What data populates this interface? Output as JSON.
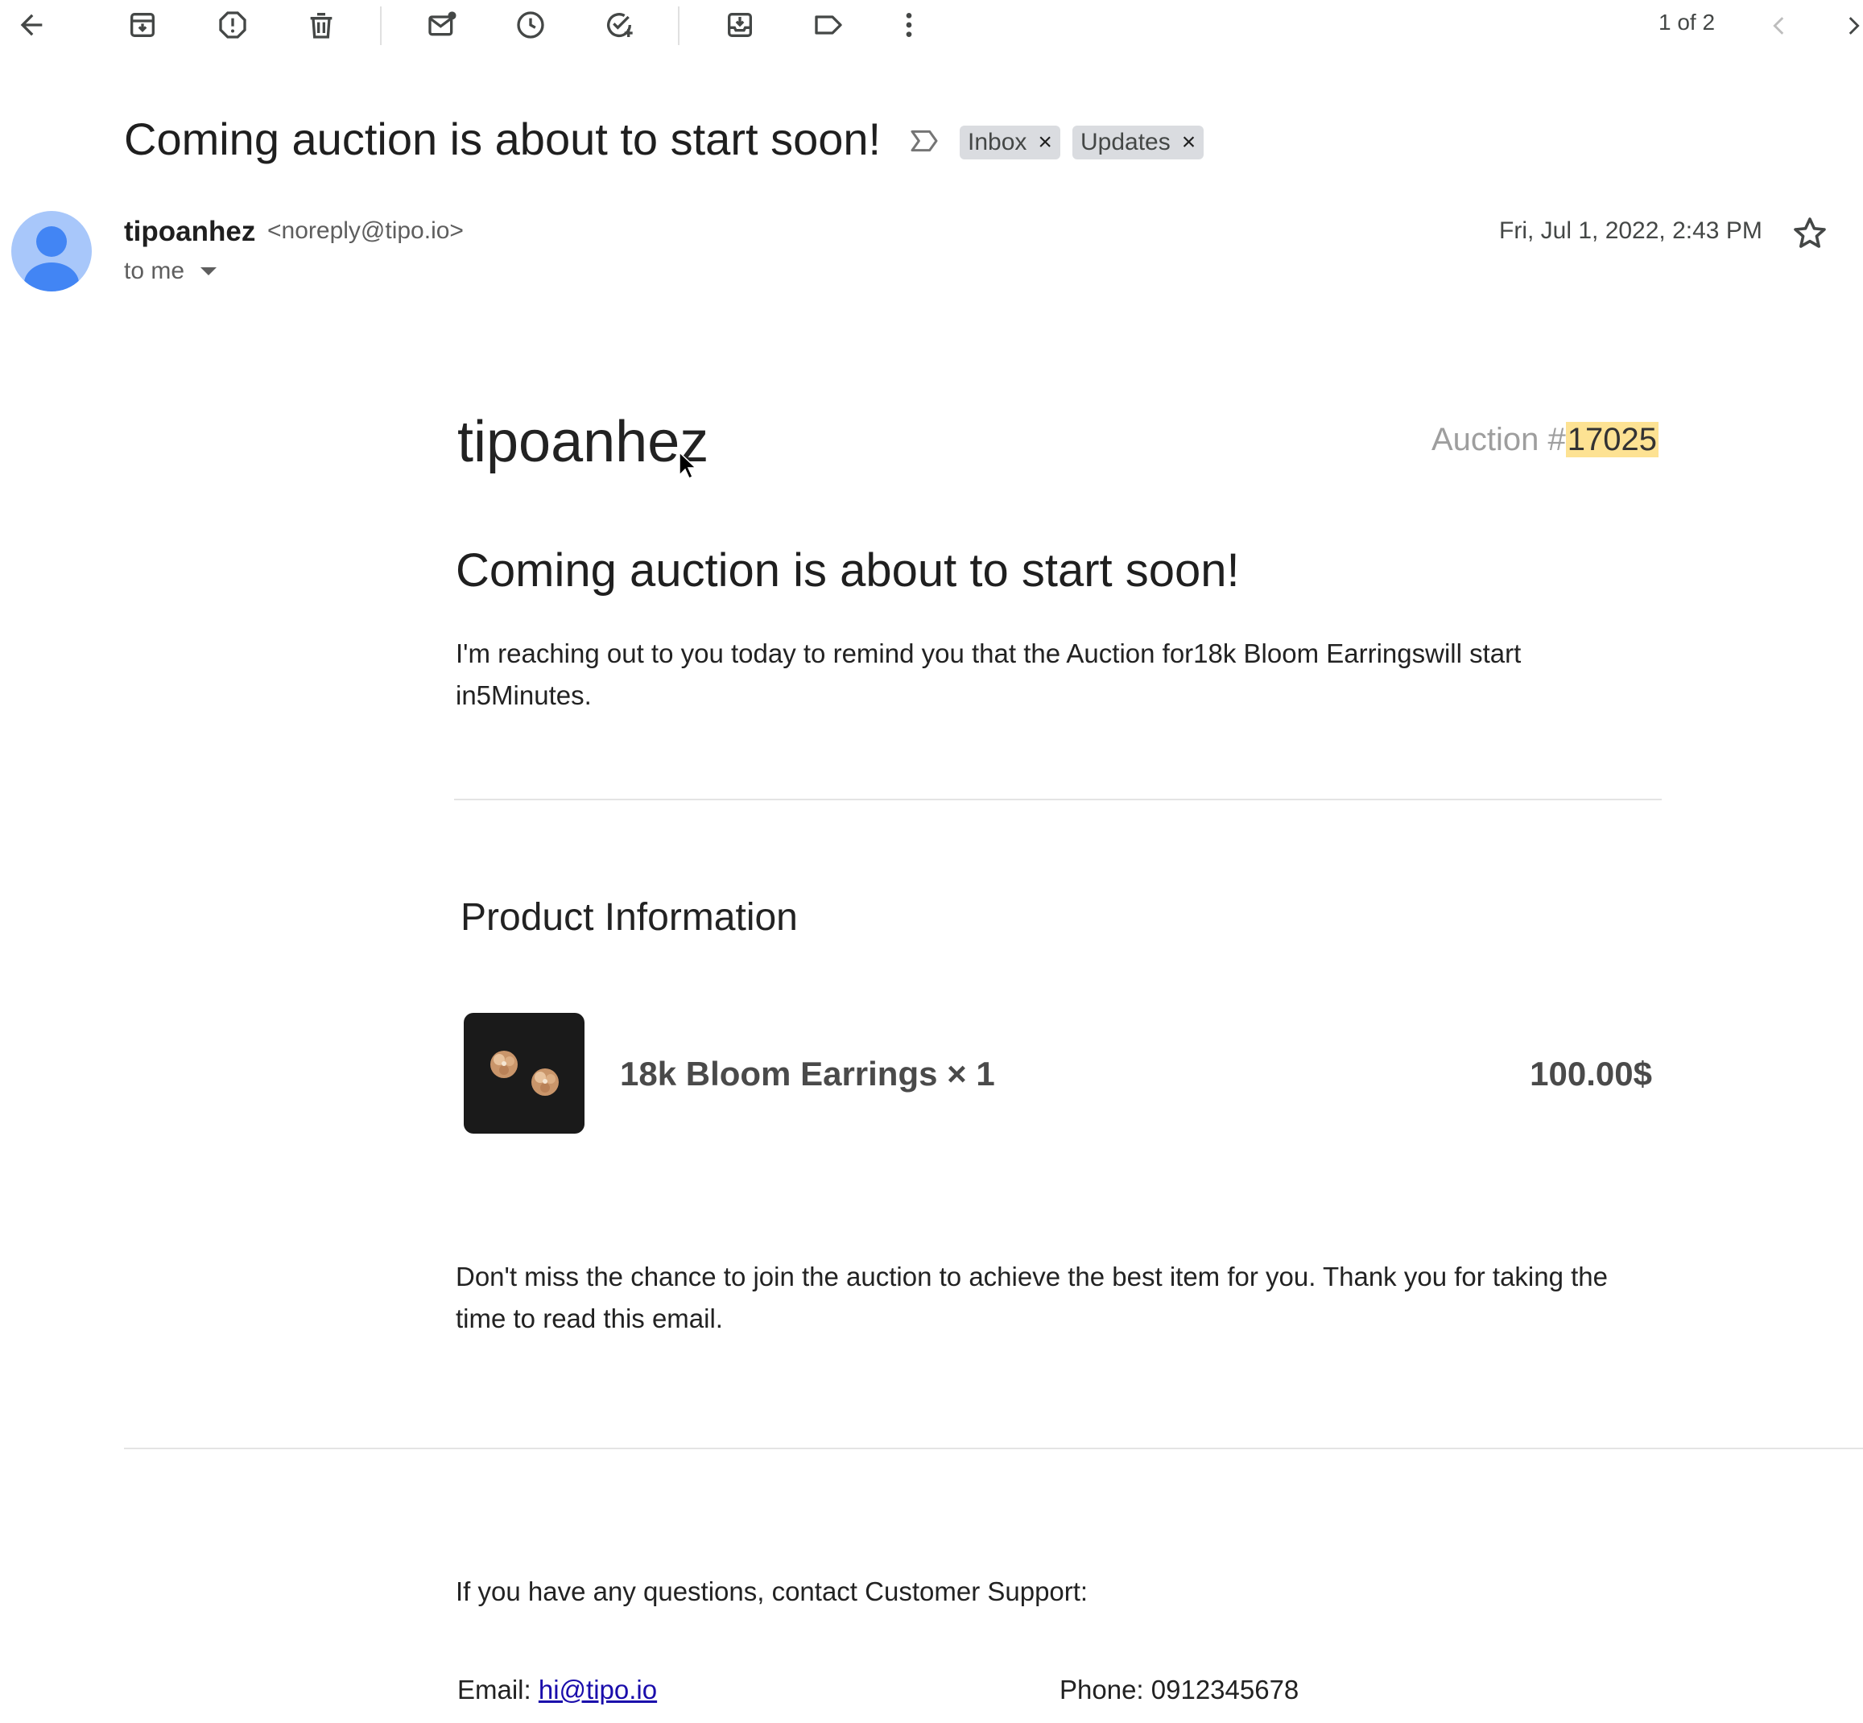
{
  "toolbar": {
    "icons": [
      "back-arrow-icon",
      "archive-icon",
      "report-spam-icon",
      "delete-icon",
      "mark-unread-icon",
      "snooze-icon",
      "add-task-icon",
      "move-to-icon",
      "label-icon",
      "more-vert-icon"
    ],
    "pager_text": "1 of 2"
  },
  "email": {
    "subject": "Coming auction is about to start soon!",
    "labels": [
      {
        "name": "Inbox",
        "remove": "×"
      },
      {
        "name": "Updates",
        "remove": "×"
      }
    ],
    "sender_name": "tipoanhez",
    "sender_email": "<noreply@tipo.io>",
    "recipient": "to me",
    "date": "Fri, Jul 1, 2022, 2:43 PM"
  },
  "body": {
    "brand": "tipoanhez",
    "auction_prefix": "Auction #",
    "auction_number": "17025",
    "headline": "Coming auction is about to start soon!",
    "intro": "I'm reaching out to you today to remind you that the Auction for18k Bloom Earringswill start in5Minutes.",
    "section_title": "Product Information",
    "product": {
      "name": "18k Bloom Earrings × 1",
      "price": "100.00$"
    },
    "closing": "Don't miss the chance to join the auction to achieve the best item for you. Thank you for taking the time to read this email.",
    "support_text": "If you have any questions, contact Customer Support:",
    "email_label": "Email: ",
    "email_link": "hi@tipo.io",
    "phone": "Phone: 0912345678"
  },
  "colors": {
    "avatar_bg": "#a8c7fa",
    "avatar_fg": "#4285f4",
    "label_chip": "#dadce0",
    "highlight": "#fde293",
    "link": "#1a0dab"
  }
}
